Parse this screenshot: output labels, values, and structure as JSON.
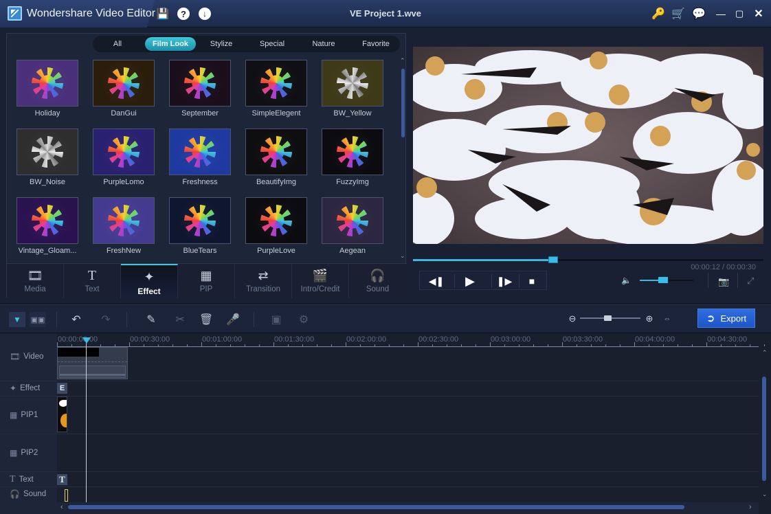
{
  "window": {
    "app_name": "Wondershare Video Editor",
    "project_title": "VE Project 1.wve",
    "left_icons": [
      "save-icon",
      "help-icon",
      "download-icon"
    ],
    "right_icons": [
      "register-key-icon",
      "cart-icon",
      "feedback-chat-icon",
      "minimize-icon",
      "maximize-icon",
      "close-icon"
    ]
  },
  "library": {
    "filters": [
      {
        "label": "All",
        "active": false
      },
      {
        "label": "Film Look",
        "active": true
      },
      {
        "label": "Stylize",
        "active": false
      },
      {
        "label": "Special",
        "active": false
      },
      {
        "label": "Nature",
        "active": false
      },
      {
        "label": "Favorite",
        "active": false
      }
    ],
    "effects": [
      {
        "name": "Holiday",
        "bg": "#4a2f7a"
      },
      {
        "name": "DanGui",
        "bg": "#2a1d0c"
      },
      {
        "name": "September",
        "bg": "#1a0e1a"
      },
      {
        "name": "SimpleElegent",
        "bg": "#101014"
      },
      {
        "name": "BW_Yellow",
        "bg": "#3e3a18"
      },
      {
        "name": "BW_Noise",
        "bg": "#2e2e2e"
      },
      {
        "name": "PurpleLomo",
        "bg": "#2a2070"
      },
      {
        "name": "Freshness",
        "bg": "#1e3aa0"
      },
      {
        "name": "BeautifyImg",
        "bg": "#0e0e10"
      },
      {
        "name": "FuzzyImg",
        "bg": "#0c0c10"
      },
      {
        "name": "Vintage_Gloam...",
        "bg": "#2a1250"
      },
      {
        "name": "FreshNew",
        "bg": "#443a90"
      },
      {
        "name": "BlueTears",
        "bg": "#0e1630"
      },
      {
        "name": "PurpleLove",
        "bg": "#0c0c10"
      },
      {
        "name": "Aegean",
        "bg": "#2c2640"
      }
    ]
  },
  "tabs": [
    {
      "label": "Media",
      "icon": "media-icon",
      "active": false
    },
    {
      "label": "Text",
      "icon": "text-icon",
      "active": false
    },
    {
      "label": "Effect",
      "icon": "magic-wand-icon",
      "active": true
    },
    {
      "label": "PIP",
      "icon": "pip-icon",
      "active": false
    },
    {
      "label": "Transition",
      "icon": "transition-icon",
      "active": false
    },
    {
      "label": "Intro/Credit",
      "icon": "intro-credit-icon",
      "active": false
    },
    {
      "label": "Sound",
      "icon": "headphones-icon",
      "active": false
    }
  ],
  "player": {
    "current_time": "00:00:12",
    "total_time": "00:00:30",
    "timecode": "00:00:12 / 00:00:30",
    "progress_fraction": 0.4,
    "volume_fraction": 0.43,
    "accent": "#35bfe8"
  },
  "toolbar": {
    "export_label": "Export",
    "zoom_fraction": 0.45
  },
  "timeline": {
    "ruler": [
      "00:00:00:00",
      "00:00:30:00",
      "00:01:00:00",
      "00:01:30:00",
      "00:02:00:00",
      "00:02:30:00",
      "00:03:00:00",
      "00:03:30:00",
      "00:04:00:00",
      "00:04:30:00"
    ],
    "tracks": [
      {
        "name": "Video",
        "icon": "film-icon"
      },
      {
        "name": "Effect",
        "icon": "magic-wand-icon",
        "badge": "E"
      },
      {
        "name": "PIP1",
        "icon": "pip-icon"
      },
      {
        "name": "PIP2",
        "icon": "pip-icon"
      },
      {
        "name": "Text",
        "icon": "text-icon",
        "badge": "T"
      },
      {
        "name": "Sound",
        "icon": "headphones-icon"
      }
    ]
  }
}
